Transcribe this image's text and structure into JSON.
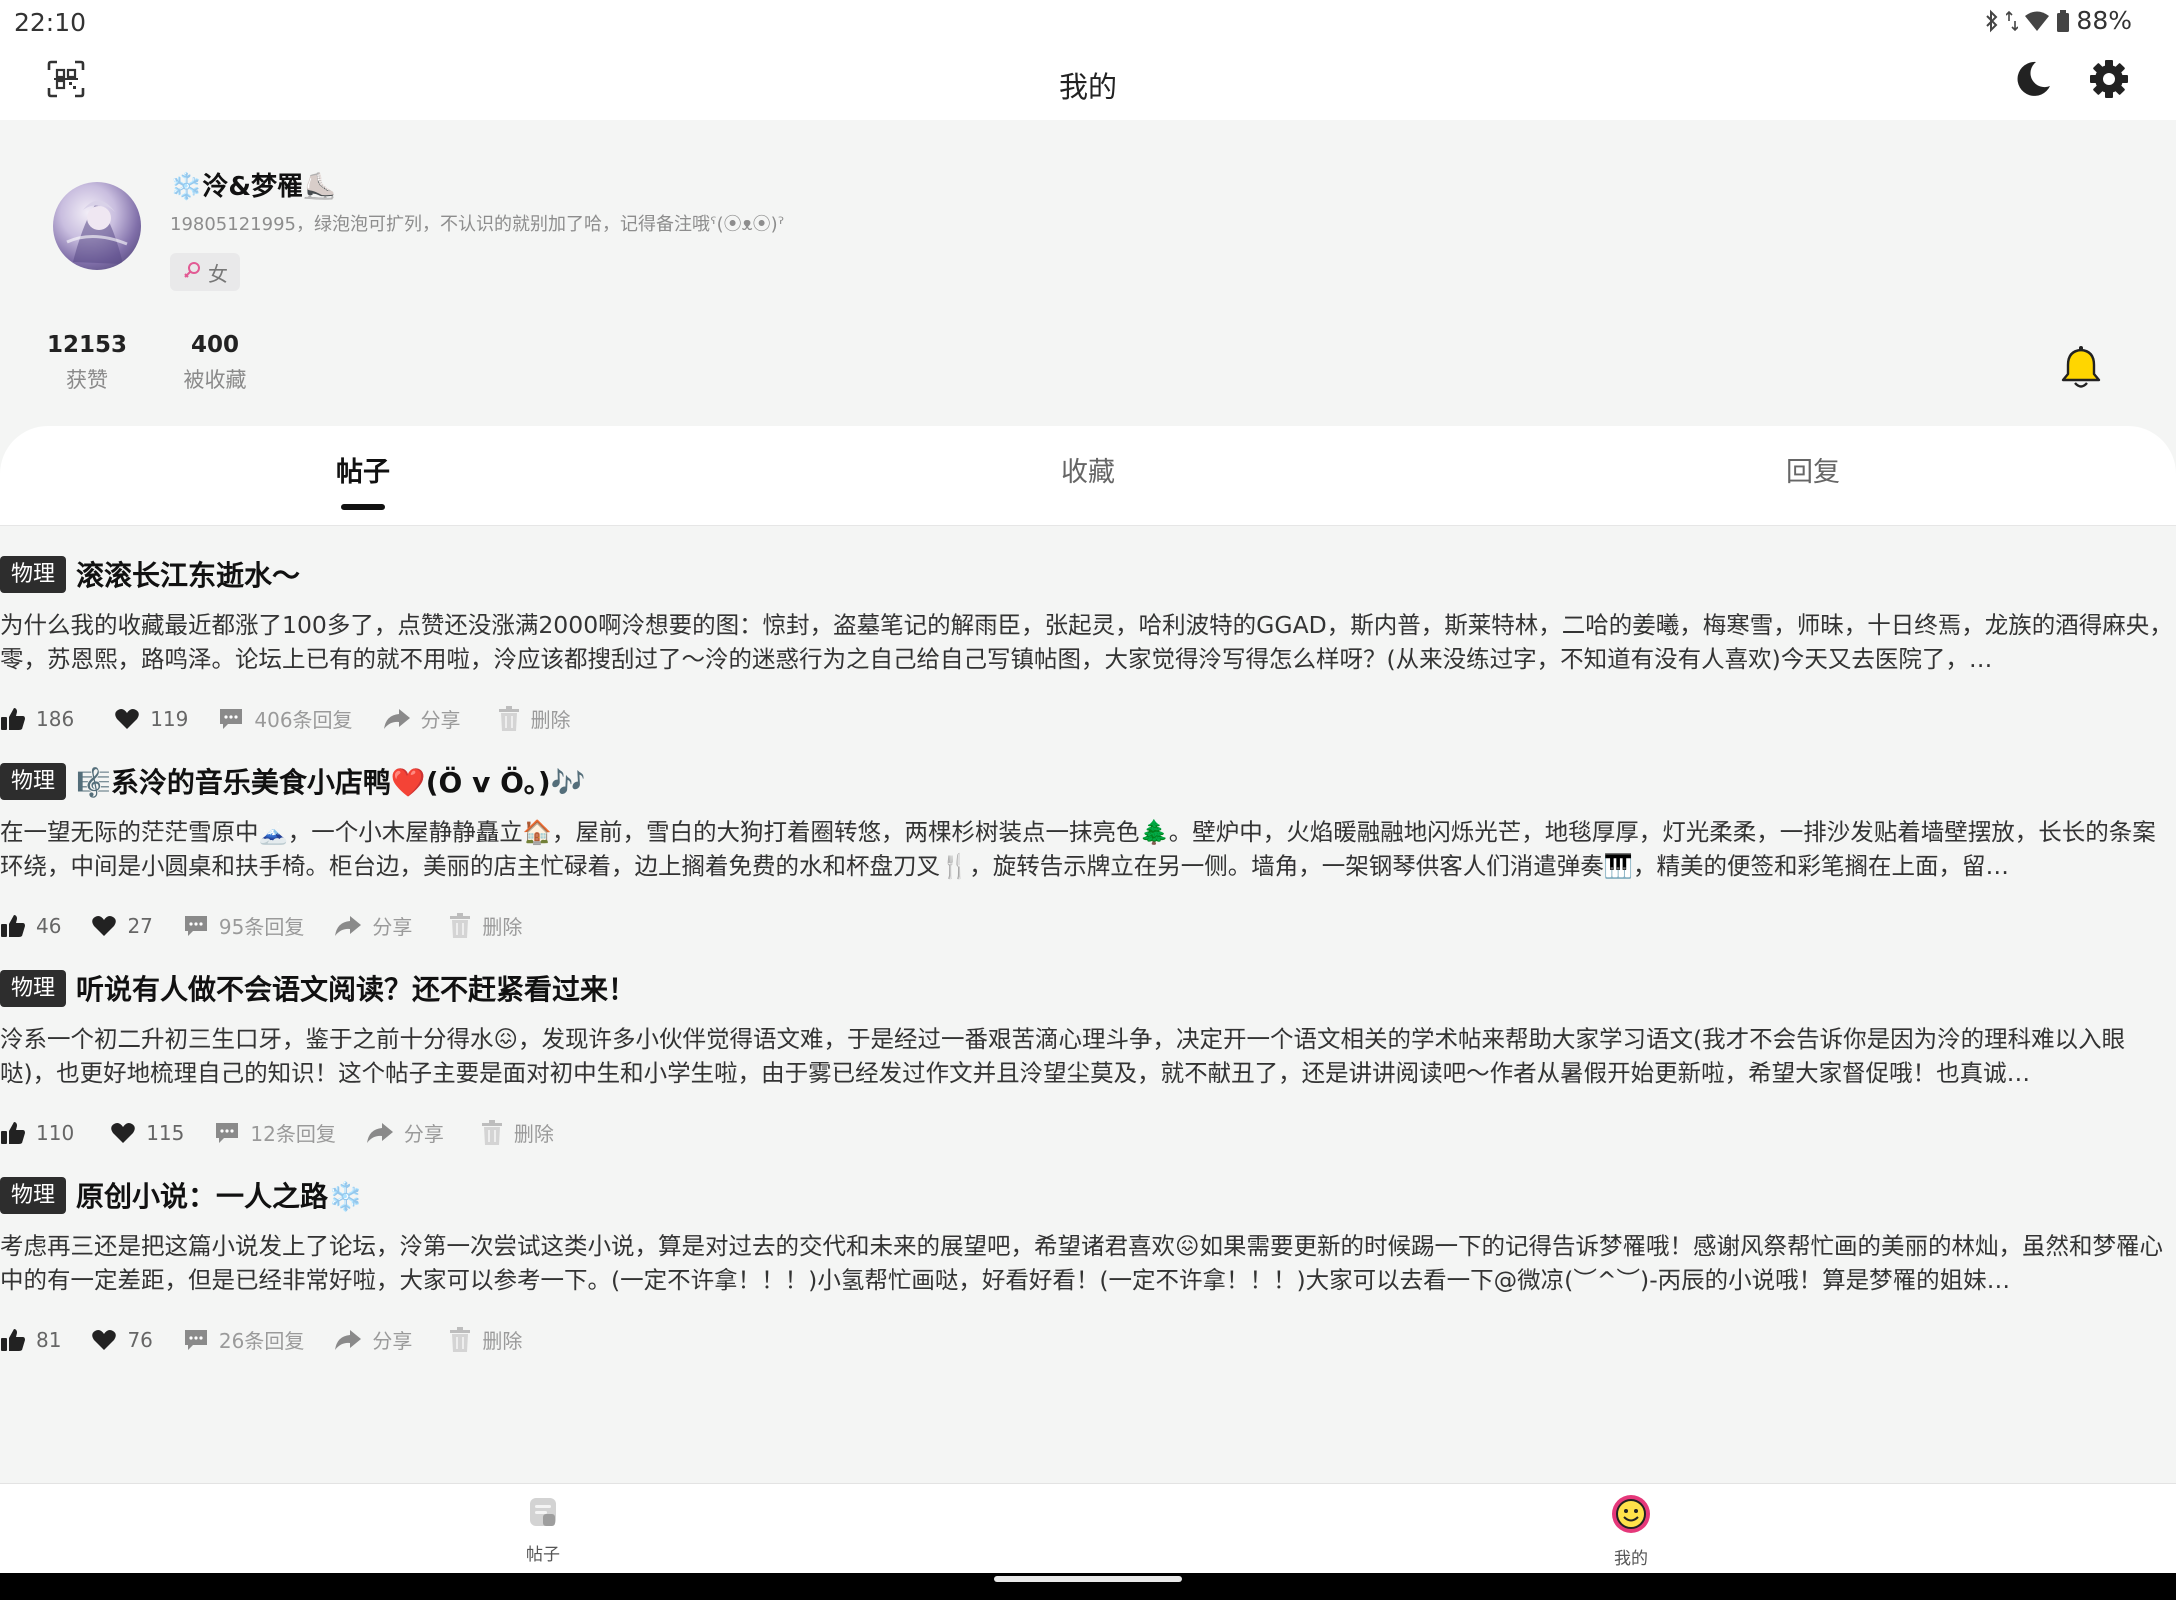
{
  "status_bar": {
    "time": "22:10",
    "battery": "88%"
  },
  "app_bar": {
    "title": "我的"
  },
  "profile": {
    "username": "❄️泠&梦罹⛸️",
    "bio": "19805121995，绿泡泡可扩列，不认识的就别加了哈，记得备注哦ˁ(⦿ᴥ⦿)ˀ",
    "gender_icon": "female-symbol-icon",
    "gender": "女",
    "stats": [
      {
        "value": "12153",
        "label": "获赞"
      },
      {
        "value": "400",
        "label": "被收藏"
      }
    ]
  },
  "tabs": [
    {
      "label": "帖子",
      "active": true
    },
    {
      "label": "收藏",
      "active": false
    },
    {
      "label": "回复",
      "active": false
    }
  ],
  "posts": [
    {
      "category": "物理",
      "title": "滚滚长江东逝水～",
      "body": "为什么我的收藏最近都涨了100多了，点赞还没涨满2000啊泠想要的图：惊封，盗墓笔记的解雨臣，张起灵，哈利波特的GGAD，斯内普，斯莱特林，二哈的姜曦，梅寒雪，师昧，十日终焉，龙族的酒得麻央，零，苏恩熙，路鸣泽。论坛上已有的就不用啦，泠应该都搜刮过了～泠的迷惑行为之自己给自己写镇帖图，大家觉得泠写得怎么样呀？(从来没练过字，不知道有没有人喜欢)今天又去医院了，…",
      "likes": "186",
      "favorites": "119",
      "replies": "406条回复",
      "share": "分享",
      "delete": "删除"
    },
    {
      "category": "物理",
      "title": "🎼系泠的音乐美食小店鸭❤️(Ö v Ö｡)🎶",
      "body": "在一望无际的茫茫雪原中🗻，一个小木屋静静矗立🏠，屋前，雪白的大狗打着圈转悠，两棵杉树装点一抹亮色🌲。壁炉中，火焰暖融融地闪烁光芒，地毯厚厚，灯光柔柔，一排沙发贴着墙壁摆放，长长的条案环绕，中间是小圆桌和扶手椅。柜台边，美丽的店主忙碌着，边上搁着免费的水和杯盘刀叉🍴，旋转告示牌立在另一侧。墙角，一架钢琴供客人们消遣弹奏🎹，精美的便签和彩笔搁在上面，留…",
      "likes": "46",
      "favorites": "27",
      "replies": "95条回复",
      "share": "分享",
      "delete": "删除"
    },
    {
      "category": "物理",
      "title": "听说有人做不会语文阅读？还不赶紧看过来！",
      "body": "泠系一个初二升初三生口牙，鉴于之前十分得水😖，发现许多小伙伴觉得语文难，于是经过一番艰苦滴心理斗争，决定开一个语文相关的学术帖来帮助大家学习语文(我才不会告诉你是因为泠的理科难以入眼哒)，也更好地梳理自己的知识！这个帖子主要是面对初中生和小学生啦，由于雾已经发过作文并且泠望尘莫及，就不献丑了，还是讲讲阅读吧～作者从暑假开始更新啦，希望大家督促哦！也真诚…",
      "likes": "110",
      "favorites": "115",
      "replies": "12条回复",
      "share": "分享",
      "delete": "删除"
    },
    {
      "category": "物理",
      "title": "原创小说：一人之路❄️",
      "body": "考虑再三还是把这篇小说发上了论坛，泠第一次尝试这类小说，算是对过去的交代和未来的展望吧，希望诸君喜欢😖如果需要更新的时候踢一下的记得告诉梦罹哦！感谢风祭帮忙画的美丽的林灿，虽然和梦罹心中的有一定差距，但是已经非常好啦，大家可以参考一下。(一定不许拿！！！)小氢帮忙画哒，好看好看！(一定不许拿！！！)大家可以去看一下@微凉(︶^︶)-丙辰的小说哦！算是梦罹的姐妹…",
      "likes": "81",
      "favorites": "76",
      "replies": "26条回复",
      "share": "分享",
      "delete": "删除"
    }
  ],
  "bottom_nav": [
    {
      "label": "帖子",
      "icon": "posts-icon"
    },
    {
      "label": "我的",
      "icon": "smiley-face-icon"
    }
  ],
  "colors": {
    "accent": "#111111",
    "bell": "#ffd600",
    "nav_avatar_ring": "#e5387a",
    "category_bg": "#2d2d2d",
    "page_bg": "#f4f5f4"
  }
}
